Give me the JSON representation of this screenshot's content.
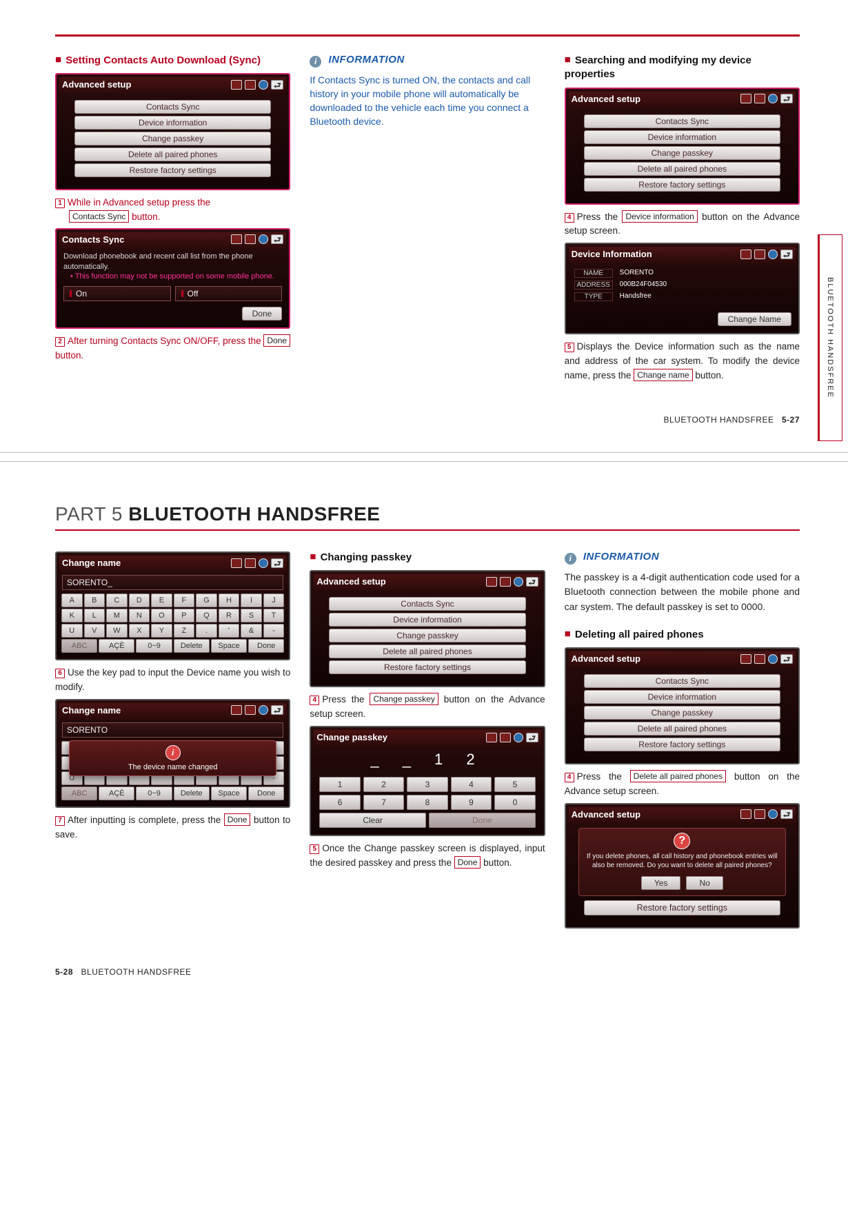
{
  "page1": {
    "col1": {
      "heading": "Setting Contacts Auto Download (Sync)",
      "screen1": {
        "title": "Advanced setup",
        "items": [
          "Contacts Sync",
          "Device information",
          "Change passkey",
          "Delete all paired phones",
          "Restore factory settings"
        ]
      },
      "step1_a": "While in Advanced setup press the",
      "step1_btn": "Contacts Sync",
      "step1_b": "button.",
      "screen2": {
        "title": "Contacts Sync",
        "desc1": "Download phonebook and recent call list from the phone automatically.",
        "desc2": "This function may not be supported on some mobile phone.",
        "on": "On",
        "off": "Off",
        "done": "Done"
      },
      "step2_a": "After turning Contacts Sync ON/OFF, press the",
      "step2_btn": "Done",
      "step2_b": "button."
    },
    "col2": {
      "heading": "INFORMATION",
      "p1": "If Contacts Sync is turned ON, the contacts and call history in your mobile phone will automatically be downloaded to the vehicle each time you connect a Bluetooth device."
    },
    "col3": {
      "heading": "Searching and modifying my device properties",
      "screen1": {
        "title": "Advanced setup",
        "items": [
          "Contacts Sync",
          "Device information",
          "Change passkey",
          "Delete all paired phones",
          "Restore factory settings"
        ]
      },
      "step4_a": "Press the",
      "step4_btn": "Device information",
      "step4_b": "button on the Advance setup screen.",
      "screen2": {
        "title": "Device Information",
        "name_lab": "NAME",
        "name_val": "SORENTO",
        "addr_lab": "ADDRESS",
        "addr_val": "000B24F04530",
        "type_lab": "TYPE",
        "type_val": "Handsfree",
        "change": "Change Name"
      },
      "step5_a": "Displays the Device information such as the name and address of the car system. To modify the device name, press the",
      "step5_btn": "Change name",
      "step5_b": "button."
    },
    "side_tab": "BLUETOOTH HANDSFREE",
    "footer": {
      "label": "BLUETOOTH HANDSFREE",
      "page": "5-27"
    }
  },
  "page2": {
    "part": {
      "pre": "PART 5",
      "title": "BLUETOOTH HANDSFREE"
    },
    "col1": {
      "screen1": {
        "title": "Change name",
        "value": "SORENTO_",
        "rows": [
          [
            "A",
            "B",
            "C",
            "D",
            "E",
            "F",
            "G",
            "H",
            "I",
            "J"
          ],
          [
            "K",
            "L",
            "M",
            "N",
            "O",
            "P",
            "Q",
            "R",
            "S",
            "T"
          ],
          [
            "U",
            "V",
            "W",
            "X",
            "Y",
            "Z",
            ".",
            "'",
            "&",
            "-"
          ]
        ],
        "bottom": [
          "ABC",
          "AÇÈ",
          "0~9",
          "Delete",
          "Space",
          "Done"
        ]
      },
      "step6": "Use the key pad to input the Device name you wish to modify.",
      "screen2": {
        "title": "Change name",
        "value": "SORENTO",
        "overlay": "The device name changed",
        "bottom": [
          "ABC",
          "AÇÈ",
          "0~9",
          "Delete",
          "Space",
          "Done"
        ]
      },
      "step7_a": "After inputting is complete, press the",
      "step7_btn": "Done",
      "step7_b": "button to save."
    },
    "col2": {
      "heading": "Changing passkey",
      "screen1": {
        "title": "Advanced setup",
        "items": [
          "Contacts Sync",
          "Device information",
          "Change passkey",
          "Delete all paired phones",
          "Restore factory settings"
        ]
      },
      "step4_a": "Press the",
      "step4_btn": "Change passkey",
      "step4_b": "button on the Advance setup screen.",
      "screen2": {
        "title": "Change passkey",
        "display": "_ _ 1 2",
        "rows": [
          [
            "1",
            "2",
            "3",
            "4",
            "5"
          ],
          [
            "6",
            "7",
            "8",
            "9",
            "0"
          ]
        ],
        "clear": "Clear",
        "done": "Done"
      },
      "step5_a": "Once the Change passkey screen is displayed, input the desired passkey and press the",
      "step5_btn": "Done",
      "step5_b": "button."
    },
    "col3": {
      "heading": "INFORMATION",
      "p1": "The passkey is a 4-digit authentication code used for a Bluetooth connection between the mobile phone and car system. The default passkey is set to 0000.",
      "heading2": "Deleting all paired phones",
      "screen1": {
        "title": "Advanced setup",
        "items": [
          "Contacts Sync",
          "Device information",
          "Change passkey",
          "Delete all paired phones",
          "Restore factory settings"
        ]
      },
      "step4_a": "Press the",
      "step4_btn": "Delete all paired phones",
      "step4_b": "button on the Advance setup screen.",
      "screen2": {
        "title": "Advanced setup",
        "confirm": "If you delete phones, all call history and phonebook entries will also be removed. Do you want to delete all paired phones?",
        "yes": "Yes",
        "no": "No",
        "restore": "Restore factory settings"
      }
    },
    "footer": {
      "page": "5-28",
      "label": "BLUETOOTH HANDSFREE"
    }
  }
}
